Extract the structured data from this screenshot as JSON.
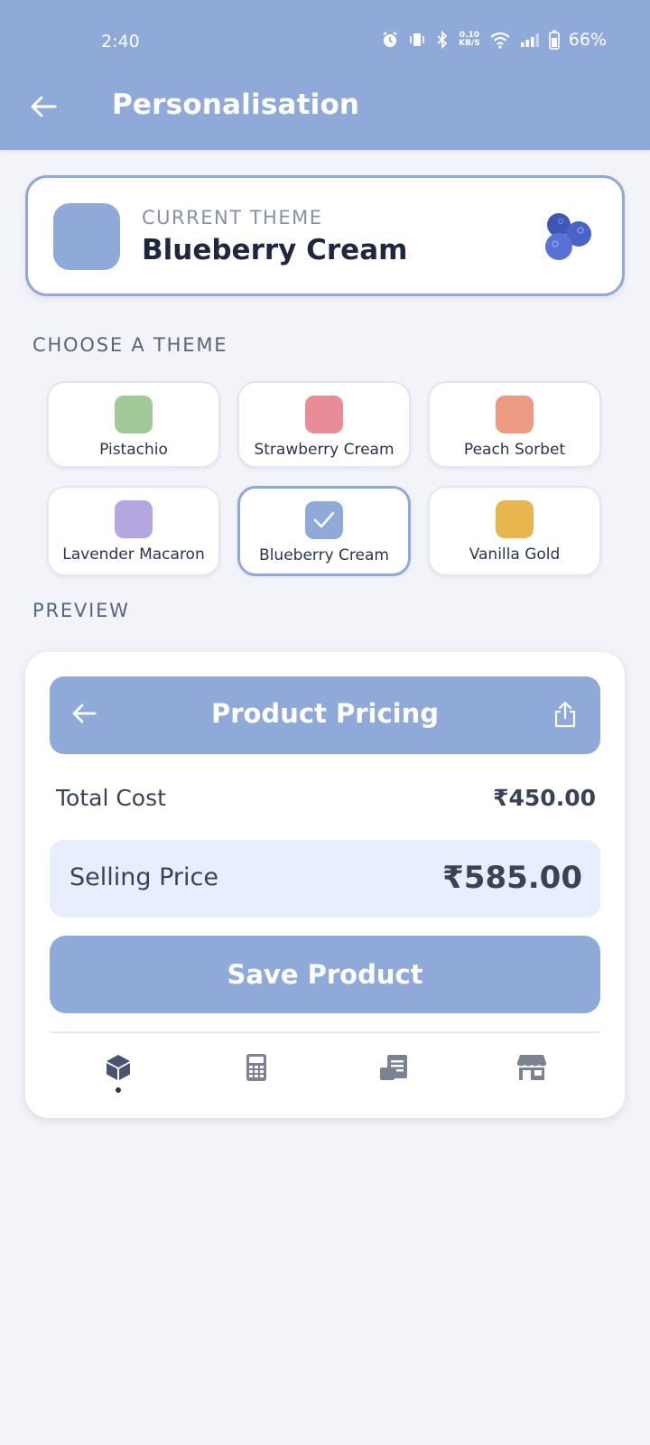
{
  "status": {
    "time": "2:40",
    "net_speed_top": "0.10",
    "net_speed_bottom": "KB/S",
    "battery": "66%"
  },
  "appbar": {
    "title": "Personalisation"
  },
  "current_theme": {
    "label": "CURRENT THEME",
    "name": "Blueberry Cream",
    "color": "#8faad8"
  },
  "choose_label": "CHOOSE A THEME",
  "themes": [
    {
      "name": "Pistachio",
      "color": "#a3c99b",
      "selected": false
    },
    {
      "name": "Strawberry Cream",
      "color": "#e88c98",
      "selected": false
    },
    {
      "name": "Peach Sorbet",
      "color": "#ec9a82",
      "selected": false
    },
    {
      "name": "Lavender Macaron",
      "color": "#b6a6e0",
      "selected": false
    },
    {
      "name": "Blueberry Cream",
      "color": "#8faad8",
      "selected": true
    },
    {
      "name": "Vanilla Gold",
      "color": "#e8b64e",
      "selected": false
    }
  ],
  "preview_label": "PREVIEW",
  "preview": {
    "title": "Product Pricing",
    "total_cost_label": "Total Cost",
    "total_cost_value": "₹450.00",
    "selling_price_label": "Selling Price",
    "selling_price_value": "₹585.00",
    "save_button": "Save Product",
    "nav": [
      "box-icon",
      "calculator-icon",
      "receipt-icon",
      "store-icon"
    ],
    "nav_active": 0
  }
}
